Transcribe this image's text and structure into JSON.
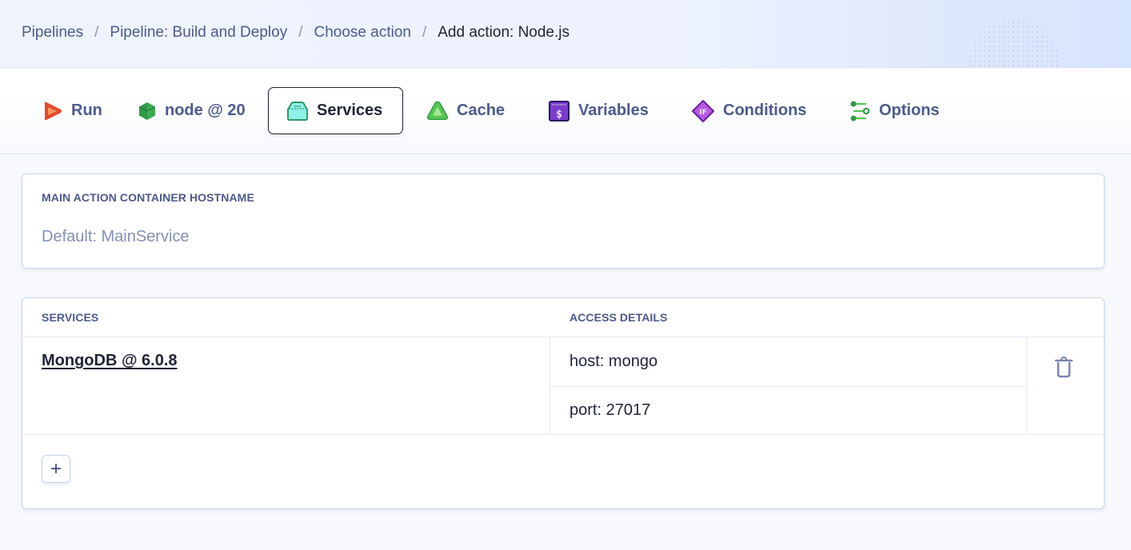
{
  "breadcrumb": {
    "items": [
      {
        "label": "Pipelines"
      },
      {
        "label": "Pipeline: Build and Deploy"
      },
      {
        "label": "Choose action"
      },
      {
        "label": "Add action: Node.js"
      }
    ],
    "separator": "/"
  },
  "tabs": [
    {
      "label": "Run",
      "icon": "run-icon",
      "active": false
    },
    {
      "label": "node @ 20",
      "icon": "node-hexagon-icon",
      "active": false
    },
    {
      "label": "Services",
      "icon": "services-box-icon",
      "active": true
    },
    {
      "label": "Cache",
      "icon": "cache-triangle-icon",
      "active": false
    },
    {
      "label": "Variables",
      "icon": "variables-dollar-icon",
      "active": false
    },
    {
      "label": "Conditions",
      "icon": "conditions-if-icon",
      "active": false
    },
    {
      "label": "Options",
      "icon": "options-sliders-icon",
      "active": false
    }
  ],
  "hostname": {
    "label": "MAIN ACTION CONTAINER HOSTNAME",
    "value": "",
    "placeholder": "Default: MainService"
  },
  "services": {
    "columns": [
      "SERVICES",
      "ACCESS DETAILS"
    ],
    "rows": [
      {
        "name": "MongoDB @ 6.0.8",
        "details": [
          "host: mongo",
          "port: 27017"
        ]
      }
    ],
    "add_label": "+"
  },
  "icons": {
    "trash": "trash-icon",
    "add": "plus-icon"
  },
  "colors": {
    "text_primary": "#1f2437",
    "text_link": "#4c5a8c",
    "placeholder": "#8490b4",
    "border": "#c5d4ee",
    "header_bg": "#eef3fe"
  }
}
